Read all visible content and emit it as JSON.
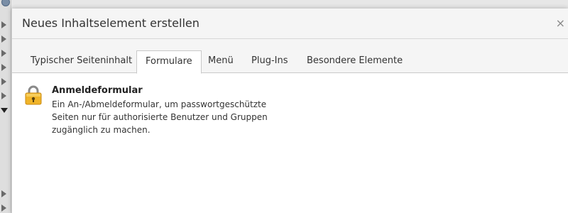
{
  "modal": {
    "title": "Neues Inhaltselement erstellen",
    "close_symbol": "×"
  },
  "tabs": [
    {
      "label": "Typischer Seiteninhalt",
      "active": false
    },
    {
      "label": "Formulare",
      "active": true
    },
    {
      "label": "Menü",
      "active": false
    },
    {
      "label": "Plug-Ins",
      "active": false
    },
    {
      "label": "Besondere Elemente",
      "active": false
    }
  ],
  "elements": [
    {
      "icon": "lock-icon",
      "title": "Anmeldeformular",
      "description_lines": [
        "Ein An-/Abmeldeformular, um passwortgeschützte",
        "Seiten nur für authorisierte Benutzer und Gruppen",
        "zugänglich zu machen."
      ]
    }
  ],
  "colors": {
    "header_bg": "#f5f5f5",
    "active_tab_bg": "#ffffff",
    "lock_body": "#f0b429",
    "lock_shackle": "#8a8a8a"
  }
}
